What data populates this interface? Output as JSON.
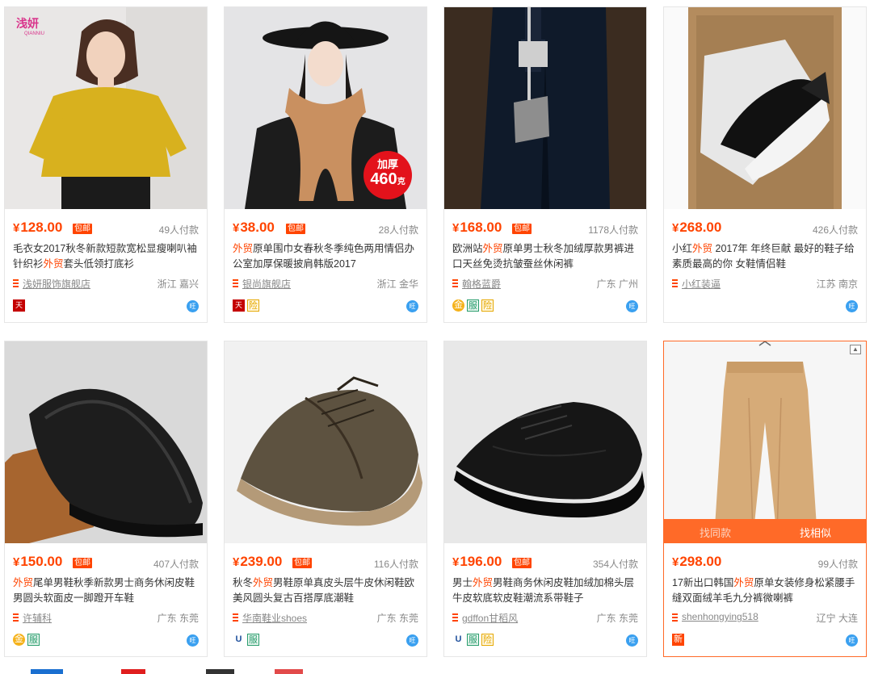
{
  "products": [
    {
      "price": "128.00",
      "baoyou": "包邮",
      "paid": "49人付款",
      "title_pre": "毛衣女2017秋冬新款短款宽松显瘦喇叭袖针织衫",
      "title_hl": "外贸",
      "title_post": "套头低领打底衫",
      "shop": "浅妍服饰旗舰店",
      "location": "浙江 嘉兴",
      "badges": [
        "tmall"
      ],
      "watermark": "浅妍",
      "watermark_sub": "QIANNIU"
    },
    {
      "price": "38.00",
      "baoyou": "包邮",
      "paid": "28人付款",
      "title_pre": "",
      "title_hl": "外贸",
      "title_post": "原单围巾女春秋冬季纯色两用情侣办公室加厚保暖披肩韩版2017",
      "shop": "银尚旗舰店",
      "location": "浙江 金华",
      "badges": [
        "tmall",
        "xian"
      ],
      "promo_top": "加厚",
      "promo_num": "460",
      "promo_unit": "克"
    },
    {
      "price": "168.00",
      "baoyou": "包邮",
      "paid": "1178人付款",
      "title_pre": "欧洲站",
      "title_hl": "外贸",
      "title_post": "原单男士秋冬加绒厚款男裤进口天丝免烫抗皱蚕丝休闲裤",
      "shop": "翰格蓝爵",
      "location": "广东 广州",
      "badges": [
        "gold",
        "fu",
        "xian"
      ]
    },
    {
      "price": "268.00",
      "baoyou": "",
      "paid": "426人付款",
      "title_pre": "小红",
      "title_hl": "外贸",
      "title_post": " 2017年 年终巨献 最好的鞋子给素质最高的你 女鞋情侣鞋",
      "shop": "小红装逼",
      "location": "江苏 南京",
      "badges": []
    },
    {
      "price": "150.00",
      "baoyou": "包邮",
      "paid": "407人付款",
      "title_pre": "",
      "title_hl": "外贸",
      "title_post": "尾单男鞋秋季新款男士商务休闲皮鞋男圆头软面皮一脚蹬开车鞋",
      "shop": "许辅科",
      "location": "广东 东莞",
      "badges": [
        "gold",
        "fu"
      ]
    },
    {
      "price": "239.00",
      "baoyou": "包邮",
      "paid": "116人付款",
      "title_pre": "秋冬",
      "title_hl": "外贸",
      "title_post": "男鞋原单真皮头层牛皮休闲鞋欧美风圆头复古百搭厚底潮鞋",
      "shop": "华南鞋业shoes",
      "location": "广东 东莞",
      "badges": [
        "shield",
        "fu"
      ]
    },
    {
      "price": "196.00",
      "baoyou": "包邮",
      "paid": "354人付款",
      "title_pre": "男士",
      "title_hl": "外贸",
      "title_post": "男鞋商务休闲皮鞋加绒加棉头层牛皮软底软皮鞋潮流系带鞋子",
      "shop": "gdffon甘稻风",
      "location": "广东 东莞",
      "badges": [
        "shield",
        "fu",
        "xian"
      ]
    },
    {
      "price": "298.00",
      "baoyou": "",
      "paid": "99人付款",
      "title_pre": "17新出口韩国",
      "title_hl": "外贸",
      "title_post": "原单女装修身松紧腰手缝双面绒羊毛九分裤微喇裤",
      "shop": "shenhongying518",
      "location": "辽宁 大连",
      "badges": [
        "xin"
      ],
      "overlay_left": "找同款",
      "overlay_right": "找相似"
    }
  ],
  "labels": {
    "yen": "¥",
    "tmall": "天",
    "xian": "险",
    "fu": "服",
    "xin": "新",
    "gold": "金",
    "shield": "U",
    "wangwang": "旺"
  },
  "colors": {
    "accent": "#ff4400",
    "overlay": "#ff6a28"
  }
}
